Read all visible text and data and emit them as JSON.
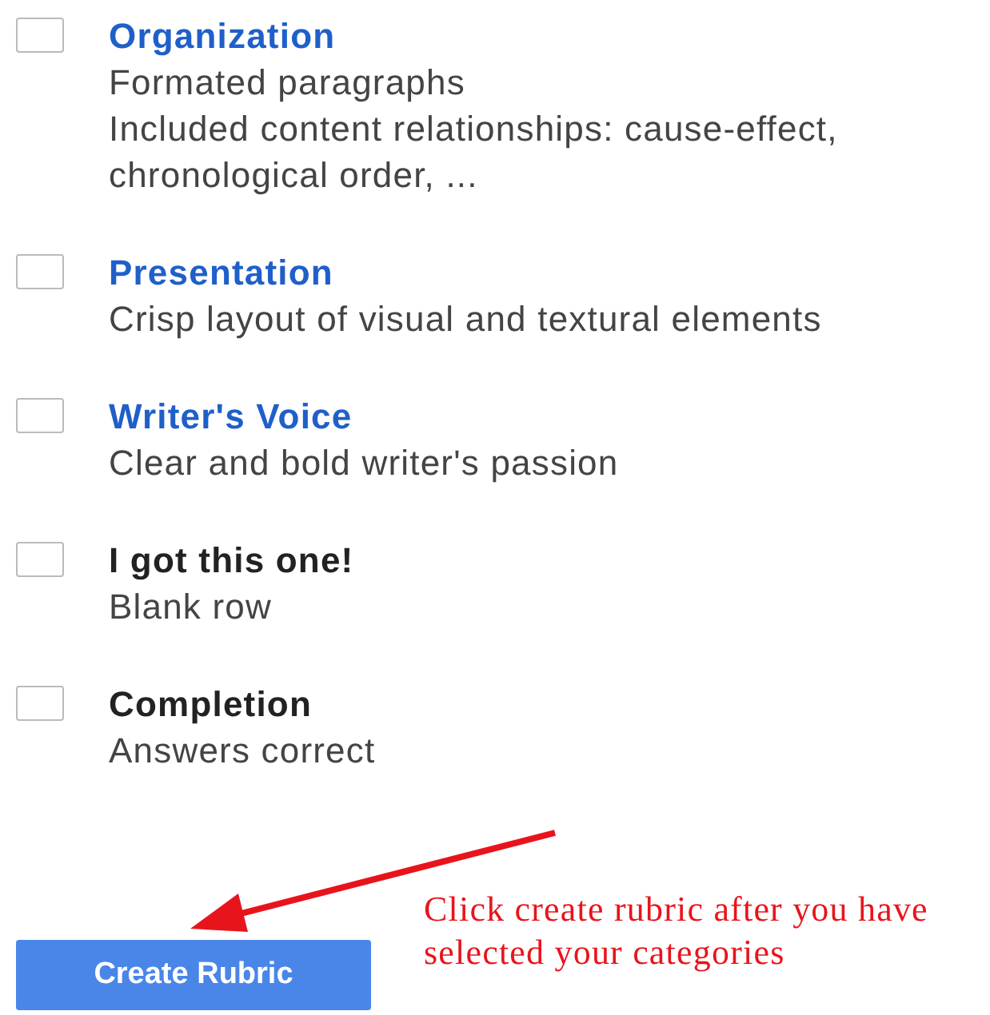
{
  "criteria": [
    {
      "title": "Organization",
      "kind": "link",
      "checked": false,
      "lines": [
        "Formated paragraphs",
        "Included content relationships: cause-effect, chronological order, ..."
      ]
    },
    {
      "title": "Presentation",
      "kind": "link",
      "checked": false,
      "lines": [
        "Crisp layout of visual and textural elements"
      ]
    },
    {
      "title": "Writer's Voice",
      "kind": "link",
      "checked": false,
      "lines": [
        "Clear and bold writer's passion"
      ]
    },
    {
      "title": "I got this one!",
      "kind": "plain",
      "checked": false,
      "lines": [
        "Blank row"
      ]
    },
    {
      "title": "Completion",
      "kind": "plain",
      "checked": false,
      "lines": [
        "Answers correct"
      ]
    }
  ],
  "button": "Create Rubric",
  "annotation": "Click create rubric after you have selected your categories"
}
